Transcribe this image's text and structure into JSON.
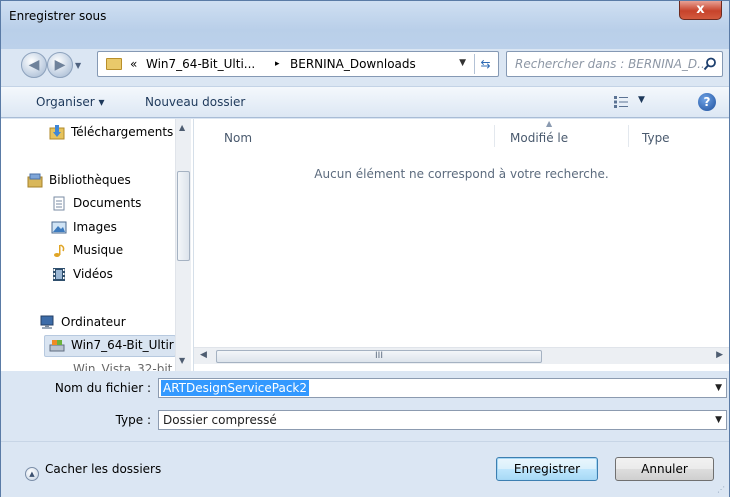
{
  "window": {
    "title": "Enregistrer sous",
    "close_label": "x"
  },
  "address": {
    "crumbs": [
      "«",
      "Win7_64-Bit_Ulti...",
      "▸",
      "BERNINA_Downloads"
    ],
    "search_placeholder": "Rechercher dans : BERNINA_D..."
  },
  "toolbar": {
    "organize": "Organiser ▾",
    "new_folder": "Nouveau dossier",
    "help": "?"
  },
  "navpane": {
    "items": [
      {
        "label": "Téléchargements",
        "icon": "downloads-folder-icon"
      },
      {
        "label": "Bibliothèques",
        "icon": "libraries-icon"
      },
      {
        "label": "Documents",
        "icon": "documents-icon"
      },
      {
        "label": "Images",
        "icon": "pictures-icon"
      },
      {
        "label": "Musique",
        "icon": "music-icon"
      },
      {
        "label": "Vidéos",
        "icon": "videos-icon"
      },
      {
        "label": "Ordinateur",
        "icon": "computer-icon"
      },
      {
        "label": "Win7_64-Bit_Ultir",
        "icon": "drive-icon"
      },
      {
        "label": "Win_Vista_32-bit",
        "icon": "drive-icon"
      }
    ]
  },
  "filelist": {
    "columns": [
      "Nom",
      "Modifié le",
      "Type"
    ],
    "empty_message": "Aucun élément ne correspond à votre recherche.",
    "scroll_grip": "III"
  },
  "form": {
    "filename_label": "Nom du fichier :",
    "filename_value": "ARTDesignServicePack2",
    "type_label": "Type :",
    "type_value": "Dossier compressé"
  },
  "footer": {
    "hide_folders": "Cacher les dossiers",
    "save": "Enregistrer",
    "cancel": "Annuler"
  },
  "colors": {
    "selection": "#3399ff",
    "chrome": "#dbe6f3"
  }
}
